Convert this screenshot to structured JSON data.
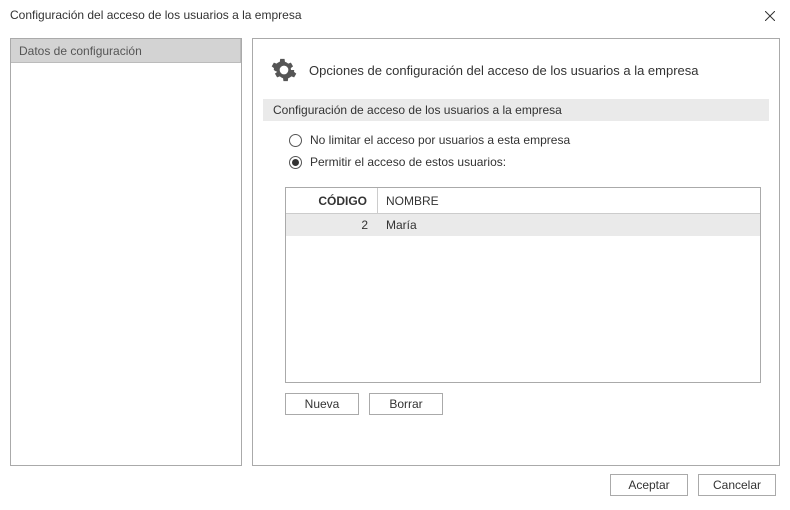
{
  "window": {
    "title": "Configuración del acceso de los usuarios a la empresa"
  },
  "sidebar": {
    "tab_label": "Datos de configuración"
  },
  "main": {
    "header_title": "Opciones de configuración del acceso de los usuarios a la empresa",
    "section_title": "Configuración de acceso de los usuarios a la empresa",
    "radios": {
      "opt_no_limit": "No limitar el acceso por usuarios a esta empresa",
      "opt_allow": "Permitir el acceso de estos usuarios:",
      "selected": "opt_allow"
    },
    "table": {
      "col_codigo": "CÓDIGO",
      "col_nombre": "NOMBRE",
      "rows": [
        {
          "codigo": "2",
          "nombre": "María"
        }
      ]
    },
    "buttons": {
      "nueva": "Nueva",
      "borrar": "Borrar"
    }
  },
  "footer": {
    "aceptar": "Aceptar",
    "cancelar": "Cancelar"
  }
}
